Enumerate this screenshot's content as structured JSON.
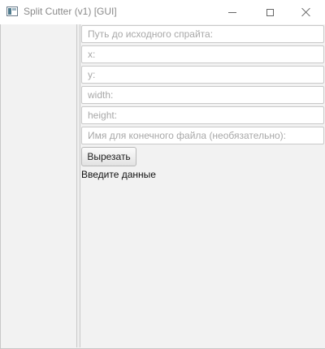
{
  "window": {
    "title": "Split Cutter (v1) [GUI]"
  },
  "form": {
    "fields": [
      {
        "placeholder": "Путь до исходного спрайта:",
        "value": ""
      },
      {
        "placeholder": "x:",
        "value": ""
      },
      {
        "placeholder": "y:",
        "value": ""
      },
      {
        "placeholder": "width:",
        "value": ""
      },
      {
        "placeholder": "height:",
        "value": ""
      },
      {
        "placeholder": "Имя для конечного файла (необязательно):",
        "value": ""
      }
    ],
    "cut_button_label": "Вырезать",
    "status_text": "Введите данные"
  }
}
